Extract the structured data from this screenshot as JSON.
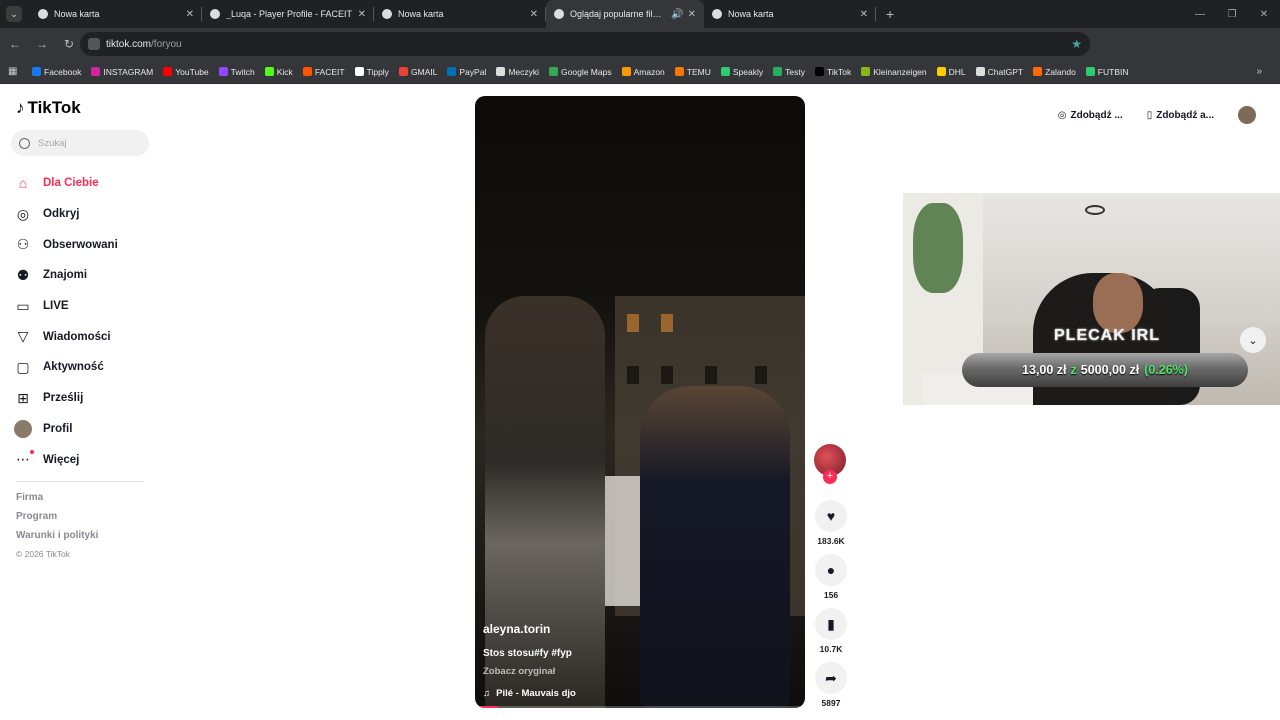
{
  "browser": {
    "tabs": [
      {
        "title": "Nowa karta",
        "active": false
      },
      {
        "title": "_Luqa - Player Profile - FACEIT",
        "active": false
      },
      {
        "title": "Nowa karta",
        "active": false
      },
      {
        "title": "Oglądaj popularne filmy | T",
        "active": true
      },
      {
        "title": "Nowa karta",
        "active": false
      }
    ],
    "url_host": "tiktok.com",
    "url_path": "/foryou",
    "bookmarks": [
      {
        "label": "Facebook",
        "color": "#1877f2"
      },
      {
        "label": "INSTAGRAM",
        "color": "#d6249f"
      },
      {
        "label": "YouTube",
        "color": "#ff0000"
      },
      {
        "label": "Twitch",
        "color": "#9146ff"
      },
      {
        "label": "Kick",
        "color": "#53fc18"
      },
      {
        "label": "FACEIT",
        "color": "#ff5500"
      },
      {
        "label": "Tipply",
        "color": "#ffffff"
      },
      {
        "label": "GMAIL",
        "color": "#ea4335"
      },
      {
        "label": "PayPal",
        "color": "#0070ba"
      },
      {
        "label": "Meczyki",
        "color": "#dddddd"
      },
      {
        "label": "Google Maps",
        "color": "#34a853"
      },
      {
        "label": "Amazon",
        "color": "#ff9900"
      },
      {
        "label": "TEMU",
        "color": "#fb7701"
      },
      {
        "label": "Speakly",
        "color": "#2ecc71"
      },
      {
        "label": "Testy",
        "color": "#27ae60"
      },
      {
        "label": "TikTok",
        "color": "#000000"
      },
      {
        "label": "Kleinanzeigen",
        "color": "#86b817"
      },
      {
        "label": "DHL",
        "color": "#ffcc00"
      },
      {
        "label": "ChatGPT",
        "color": "#dddddd"
      },
      {
        "label": "Zalando",
        "color": "#ff6900"
      },
      {
        "label": "FUTBIN",
        "color": "#2ecc71"
      }
    ]
  },
  "sidebar": {
    "logo": "TikTok",
    "search_placeholder": "Szukaj",
    "items": [
      {
        "label": "Dla Ciebie",
        "icon": "home-icon",
        "glyph": "⌂",
        "active": true
      },
      {
        "label": "Odkryj",
        "icon": "compass-icon",
        "glyph": "◎",
        "active": false
      },
      {
        "label": "Obserwowani",
        "icon": "following-icon",
        "glyph": "⚇",
        "active": false
      },
      {
        "label": "Znajomi",
        "icon": "friends-icon",
        "glyph": "⚉",
        "active": false
      },
      {
        "label": "LIVE",
        "icon": "live-icon",
        "glyph": "▭",
        "active": false
      },
      {
        "label": "Wiadomości",
        "icon": "messages-icon",
        "glyph": "▽",
        "active": false
      },
      {
        "label": "Aktywność",
        "icon": "activity-icon",
        "glyph": "▢",
        "active": false
      },
      {
        "label": "Prześlij",
        "icon": "upload-icon",
        "glyph": "⊞",
        "active": false
      },
      {
        "label": "Profil",
        "icon": "profile-avatar",
        "glyph": "",
        "active": false
      },
      {
        "label": "Więcej",
        "icon": "more-icon",
        "glyph": "⋯",
        "active": false
      }
    ],
    "footer": [
      "Firma",
      "Program",
      "Warunki i polityki"
    ],
    "copyright": "© 2026 TikTok"
  },
  "video": {
    "author": "aleyna.torin",
    "description": "Stos stosu#fy #fyp",
    "see_original": "Zobacz oryginał",
    "music": "Pilé - Mauvais djo",
    "progress": 0.07
  },
  "actions": {
    "likes": "183.6K",
    "comments": "156",
    "saves": "10.7K",
    "shares": "5897"
  },
  "header": {
    "btn1": "Zdobądź ...",
    "btn2": "Zdobądź a..."
  },
  "stream_overlay": {
    "name": "PLECAK IRL",
    "goal_current": "13,00 zł",
    "goal_separator": "z",
    "goal_target": "5000,00 zł",
    "goal_percent": "(0.26%)"
  }
}
